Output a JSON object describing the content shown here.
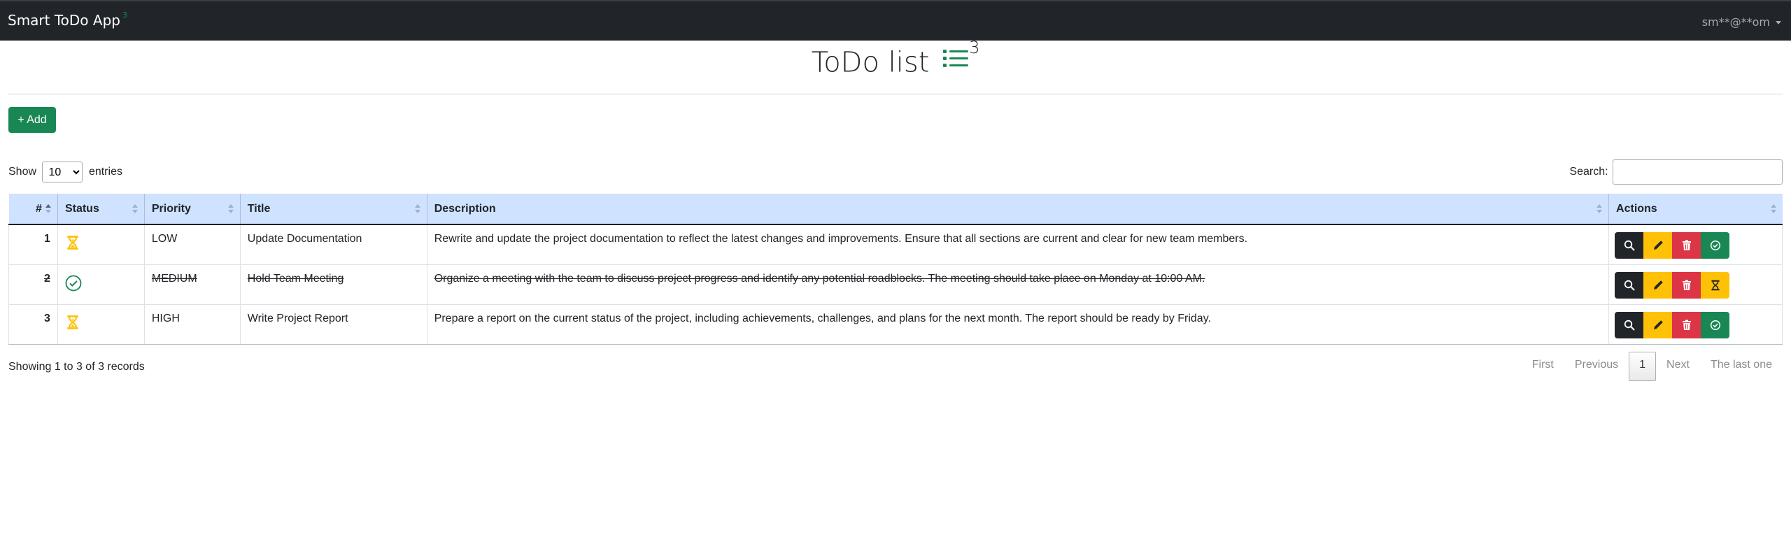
{
  "navbar": {
    "brand": "Smart ToDo App",
    "brand_badge": "3",
    "user": "sm**@**om"
  },
  "header": {
    "title": "ToDo list",
    "count": "3",
    "add_button": "+ Add"
  },
  "controls": {
    "show_label": "Show",
    "entries_value": "10",
    "entries_label": "entries",
    "search_label": "Search:",
    "search_value": ""
  },
  "table": {
    "columns": [
      "#",
      "Status",
      "Priority",
      "Title",
      "Description",
      "Actions"
    ],
    "rows": [
      {
        "num": "1",
        "status": "pending",
        "priority": "LOW",
        "title": "Update Documentation",
        "description": "Rewrite and update the project documentation to reflect the latest changes and improvements. Ensure that all sections are current and clear for new team members.",
        "done": false
      },
      {
        "num": "2",
        "status": "completed",
        "priority": "MEDIUM",
        "title": "Hold Team Meeting",
        "description": "Organize a meeting with the team to discuss project progress and identify any potential roadblocks. The meeting should take place on Monday at 10:00 AM.",
        "done": true
      },
      {
        "num": "3",
        "status": "pending",
        "priority": "HIGH",
        "title": "Write Project Report",
        "description": "Prepare a report on the current status of the project, including achievements, challenges, and plans for the next month. The report should be ready by Friday.",
        "done": false
      }
    ]
  },
  "footer": {
    "info": "Showing 1 to 3 of 3 records",
    "pager": {
      "first": "First",
      "previous": "Previous",
      "current": "1",
      "next": "Next",
      "last": "The last one"
    }
  },
  "colors": {
    "navbar": "#212529",
    "success": "#198754",
    "warning": "#ffc107",
    "danger": "#dc3545",
    "header_bg": "#cfe2ff"
  },
  "icons": {
    "view": "search-icon",
    "edit": "pencil-icon",
    "delete": "trash-icon",
    "complete": "check-circle-icon",
    "reopen": "hourglass-icon",
    "title": "list-icon"
  }
}
